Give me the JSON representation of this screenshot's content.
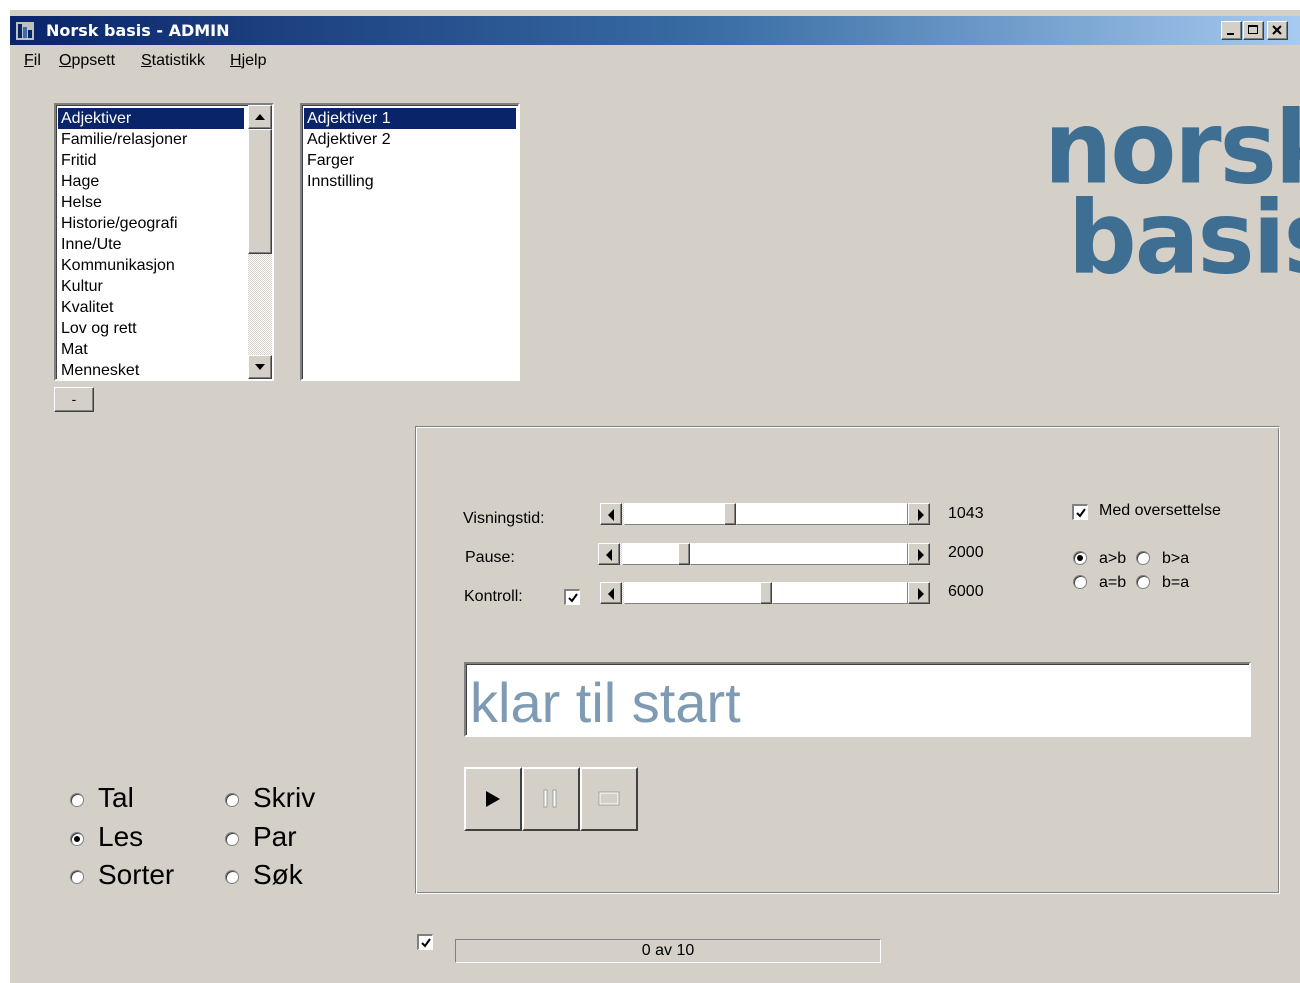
{
  "window": {
    "title": "Norsk basis - ADMIN",
    "colors": {
      "face": "#d4d0c8",
      "title_active": "#0a246a",
      "selection": "#0a246a",
      "logo": "#3e6e92",
      "display_text": "#7f9bb3"
    }
  },
  "menu": {
    "items": [
      {
        "hot": "F",
        "rest": "il"
      },
      {
        "hot": "O",
        "rest": "ppsett"
      },
      {
        "hot": "S",
        "rest": "tatistikk"
      },
      {
        "hot": "H",
        "rest": "jelp"
      }
    ]
  },
  "categories": {
    "items": [
      "Adjektiver",
      "Familie/relasjoner",
      "Fritid",
      "Hage",
      "Helse",
      "Historie/geografi",
      "Inne/Ute",
      "Kommunikasjon",
      "Kultur",
      "Kvalitet",
      "Lov og rett",
      "Mat",
      "Mennesket"
    ],
    "selected": "Adjektiver"
  },
  "lessons": {
    "items": [
      "Adjektiver 1",
      "Adjektiver 2",
      "Farger",
      "Innstilling"
    ],
    "selected": "Adjektiver 1"
  },
  "minus_button": {
    "label": "-"
  },
  "logo": {
    "line1": "norsk",
    "line2": "basis"
  },
  "settings": {
    "visningstid": {
      "label": "Visningstid:",
      "value": "1043"
    },
    "pause": {
      "label": "Pause:",
      "value": "2000"
    },
    "kontroll": {
      "label": "Kontroll:",
      "value": "6000",
      "checked": true
    },
    "med_oversettelse": {
      "label": "Med oversettelse",
      "checked": true
    },
    "direction": [
      {
        "label": "a>b",
        "checked": true
      },
      {
        "label": "b>a",
        "checked": false
      },
      {
        "label": "a=b",
        "checked": false
      },
      {
        "label": "b=a",
        "checked": false
      }
    ]
  },
  "display": {
    "text": "klar til start"
  },
  "controls": {
    "play": "play-icon",
    "pause": "pause-icon",
    "stop": "stop-icon"
  },
  "modes": [
    {
      "label": "Tal",
      "checked": false
    },
    {
      "label": "Skriv",
      "checked": false
    },
    {
      "label": "Les",
      "checked": true
    },
    {
      "label": "Par",
      "checked": false
    },
    {
      "label": "Sorter",
      "checked": false
    },
    {
      "label": "Søk",
      "checked": false
    }
  ],
  "footer": {
    "checkbox_checked": true,
    "progress_text": "0 av 10"
  }
}
